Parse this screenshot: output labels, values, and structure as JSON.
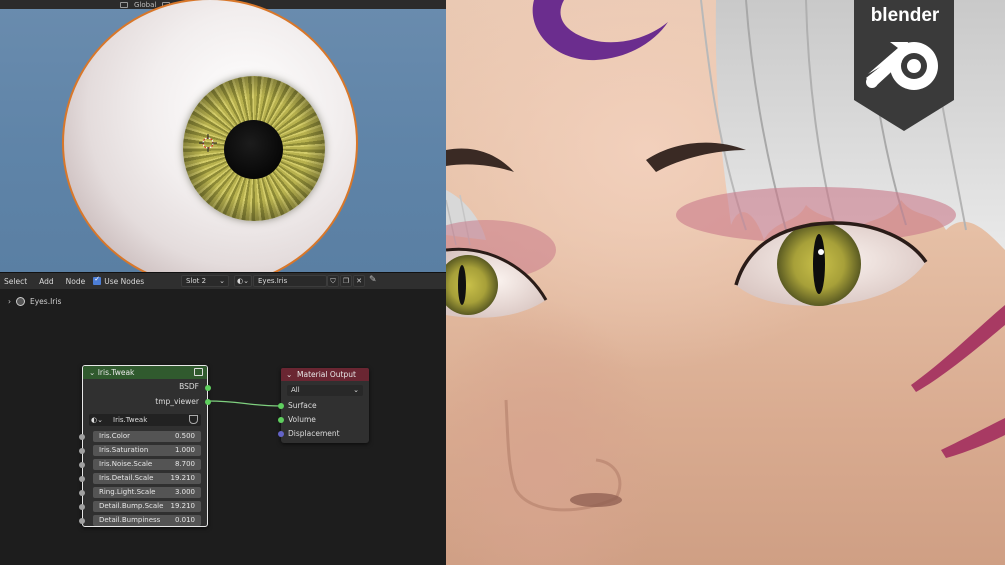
{
  "viewport": {
    "header_label": "Global"
  },
  "node_editor": {
    "menus": [
      "Select",
      "Add",
      "Node"
    ],
    "use_nodes_label": "Use Nodes",
    "slot": "Slot 2",
    "material_name": "Eyes.Iris",
    "breadcrumb": "Eyes.Iris"
  },
  "iris_node": {
    "title": "Iris.Tweak",
    "outputs": [
      "BSDF",
      "tmp_viewer"
    ],
    "group_name": "Iris.Tweak",
    "params": [
      {
        "label": "Iris.Color",
        "value": "0.500"
      },
      {
        "label": "Iris.Saturation",
        "value": "1.000"
      },
      {
        "label": "Iris.Noise.Scale",
        "value": "8.700"
      },
      {
        "label": "Iris.Detail.Scale",
        "value": "19.210"
      },
      {
        "label": "Ring.Light.Scale",
        "value": "3.000"
      },
      {
        "label": "Detail.Bump.Scale",
        "value": "19.210"
      },
      {
        "label": "Detail.Bumpiness",
        "value": "0.010"
      }
    ]
  },
  "output_node": {
    "title": "Material Output",
    "target": "All",
    "inputs": [
      "Surface",
      "Volume",
      "Displacement"
    ]
  },
  "logo": {
    "text": "blender",
    "icon": "blender-logo-icon"
  },
  "colors": {
    "group_header": "#305a2e",
    "output_header": "#6a2632",
    "shader_socket": "#5fcf5f",
    "value_socket": "#a1a1a1",
    "vector_socket": "#6363c7",
    "badge": "#3a3a3a"
  }
}
